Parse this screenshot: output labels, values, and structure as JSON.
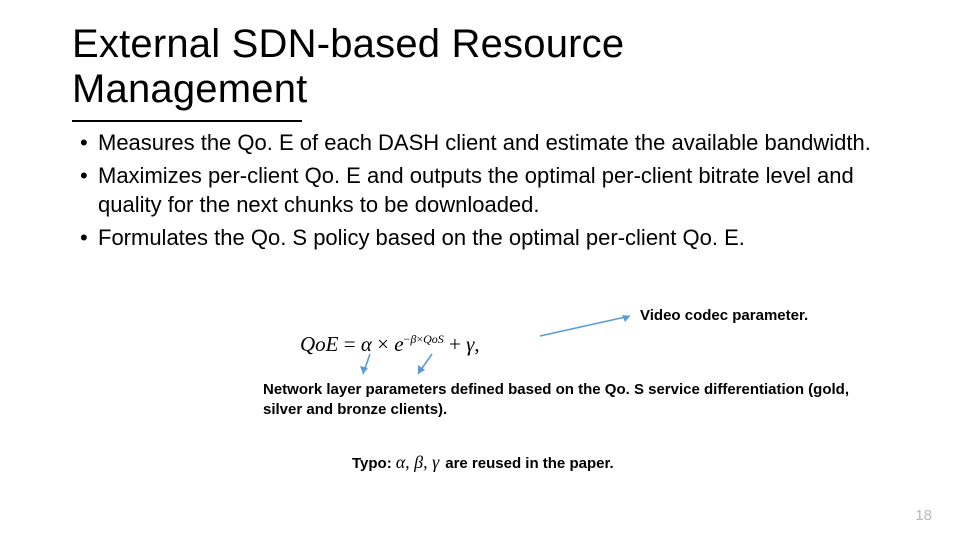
{
  "title_line1": "External SDN-based Resource",
  "title_line2": "Management",
  "bullets": [
    "Measures  the Qo. E of each DASH client and estimate the available bandwidth.",
    "Maximizes per-client Qo. E and outputs the optimal per-client bitrate level and quality for the next chunks to be downloaded.",
    "Formulates the Qo. S policy based on the optimal per-client Qo. E."
  ],
  "formula": {
    "lhs": "QoE",
    "eq": " = ",
    "alpha": "α",
    "times": " × ",
    "e": "e",
    "exp_prefix": "−",
    "exp_beta": "β",
    "exp_times": "×",
    "exp_qos": "QoS",
    "plus": " + ",
    "gamma": "γ",
    "comma": ","
  },
  "label_codec": "Video codec parameter.",
  "label_network": "Network layer parameters defined based on the Qo. S service  differentiation (gold, silver and bronze clients).",
  "typo_prefix": "Typo:",
  "typo_greek": "α, β, γ",
  "typo_suffix": "are reused in the paper.",
  "page_number": "18"
}
